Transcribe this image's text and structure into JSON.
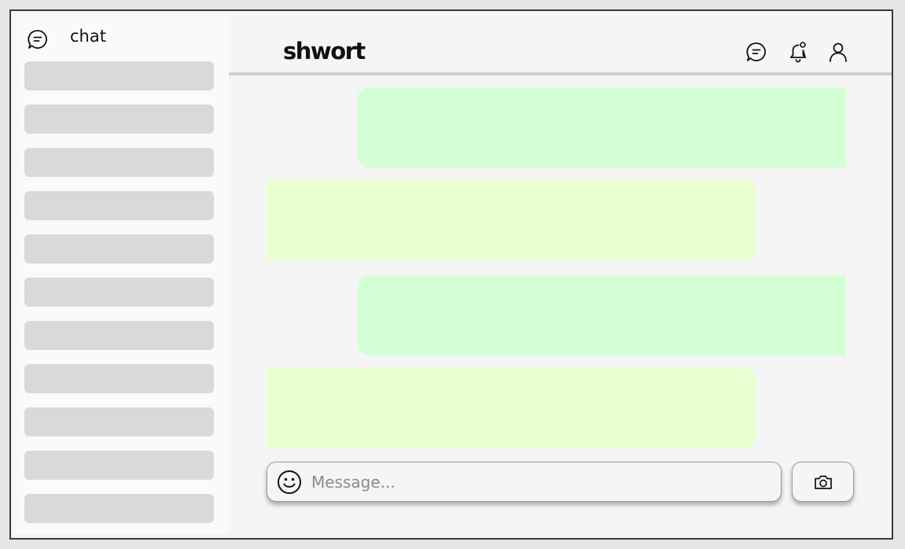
{
  "app": {
    "brand": "shwort"
  },
  "sidebar": {
    "header_label": "chat",
    "header_icon": "chat-bubble-icon",
    "item_count": 11
  },
  "header": {
    "icons": [
      "chat-bubble-icon",
      "bell-notification-icon",
      "user-profile-icon"
    ]
  },
  "messages": [
    {
      "direction": "outgoing",
      "text": ""
    },
    {
      "direction": "incoming",
      "text": ""
    },
    {
      "direction": "outgoing",
      "text": ""
    },
    {
      "direction": "incoming",
      "text": ""
    }
  ],
  "composer": {
    "placeholder": "Message...",
    "value": "",
    "emoji_icon": "smiley-icon",
    "camera_icon": "camera-icon"
  },
  "colors": {
    "outgoing_bubble": "#d4ffd4",
    "incoming_bubble": "#eaffd0",
    "sidebar_placeholder": "#d9d9d9",
    "background": "#f5f5f5"
  }
}
